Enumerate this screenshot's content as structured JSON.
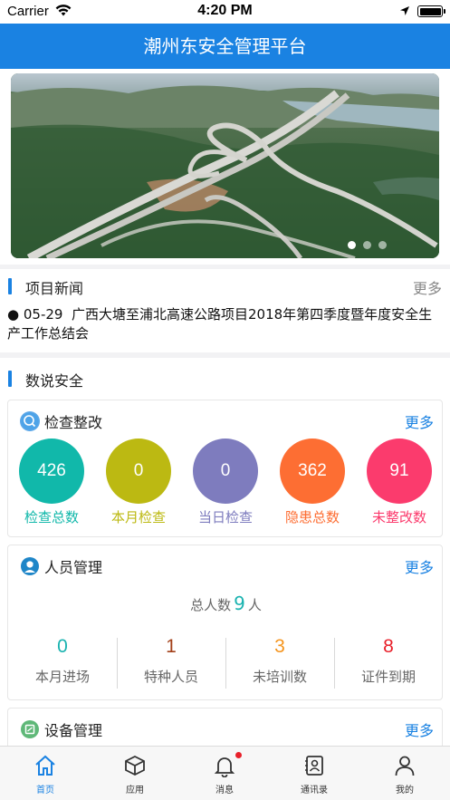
{
  "status_bar": {
    "carrier": "Carrier",
    "time": "4:20 PM"
  },
  "header": {
    "title": "潮州东安全管理平台"
  },
  "banner": {
    "slide_count": 3,
    "active_slide": 0
  },
  "news": {
    "title": "项目新闻",
    "more": "更多",
    "items": [
      {
        "date": "05-29",
        "text": "广西大塘至浦北高速公路项目2018年第四季度暨年度安全生产工作总结会"
      }
    ]
  },
  "data_section": {
    "title": "数说安全"
  },
  "inspection": {
    "title": "检查整改",
    "more": "更多",
    "stats": [
      {
        "value": "426",
        "label": "检查总数",
        "color": "#11b8aa"
      },
      {
        "value": "0",
        "label": "本月检查",
        "color": "#bcb912"
      },
      {
        "value": "0",
        "label": "当日检查",
        "color": "#7e7cbe"
      },
      {
        "value": "362",
        "label": "隐患总数",
        "color": "#fd6e33"
      },
      {
        "value": "91",
        "label": "未整改数",
        "color": "#fb3b6d"
      }
    ]
  },
  "personnel": {
    "title": "人员管理",
    "more": "更多",
    "total_prefix": "总人数",
    "total": "9",
    "total_suffix": "人",
    "stats": [
      {
        "value": "0",
        "label": "本月进场",
        "color": "#1ab3b0"
      },
      {
        "value": "1",
        "label": "特种人员",
        "color": "#a3411a"
      },
      {
        "value": "3",
        "label": "未培训数",
        "color": "#f5951e"
      },
      {
        "value": "8",
        "label": "证件到期",
        "color": "#e8202a"
      }
    ]
  },
  "equipment": {
    "title": "设备管理",
    "more": "更多"
  },
  "tabbar": {
    "items": [
      {
        "label": "首页",
        "icon": "home-icon",
        "active": true
      },
      {
        "label": "应用",
        "icon": "cube-icon",
        "active": false
      },
      {
        "label": "消息",
        "icon": "bell-icon",
        "active": false,
        "badge": true
      },
      {
        "label": "通讯录",
        "icon": "contacts-icon",
        "active": false
      },
      {
        "label": "我的",
        "icon": "person-icon",
        "active": false
      }
    ]
  },
  "colors": {
    "primary": "#1a82e2"
  }
}
